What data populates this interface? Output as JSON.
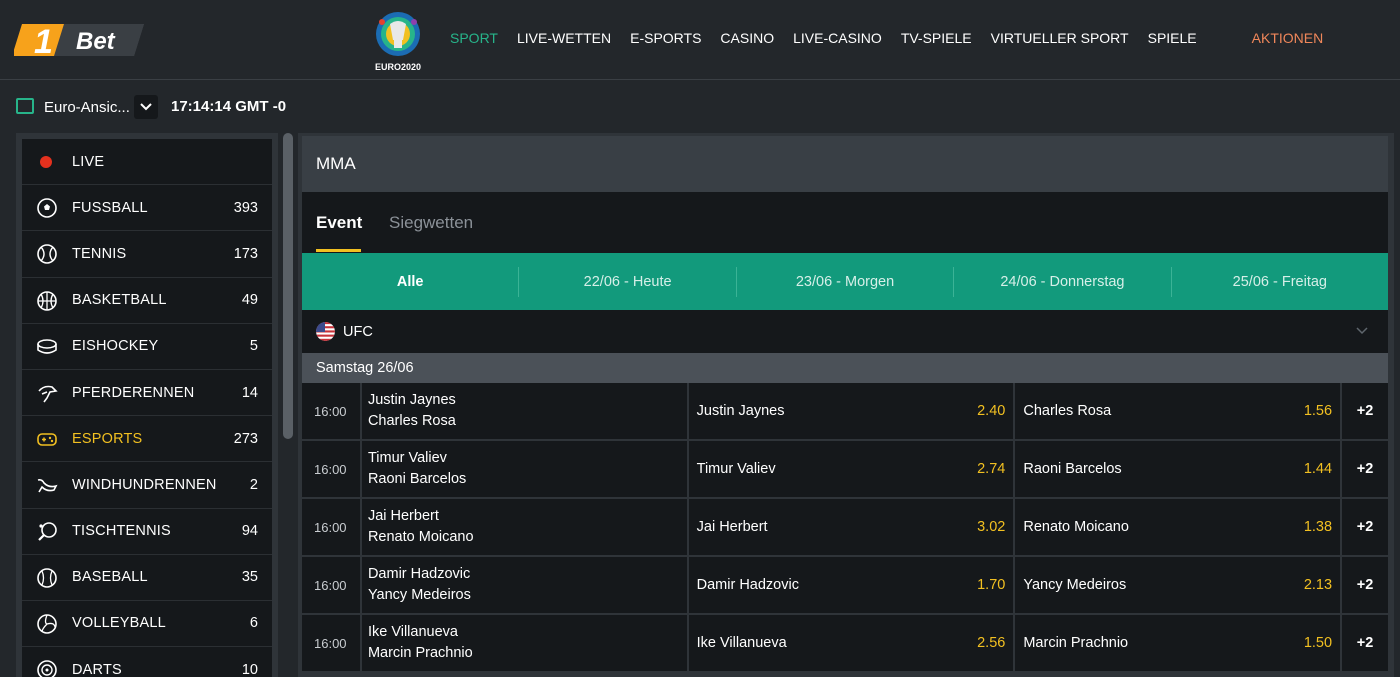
{
  "brand": {
    "logo_digit": "1",
    "logo_text": "Bet",
    "euro_text": "EURO2020"
  },
  "nav": {
    "items": [
      "SPORT",
      "LIVE-WETTEN",
      "E-SPORTS",
      "CASINO",
      "LIVE-CASINO",
      "TV-SPIELE",
      "VIRTUELLER SPORT",
      "SPIELE"
    ],
    "promo": "AKTIONEN",
    "active_color": "#27b48a",
    "promo_color": "#f0875a"
  },
  "subbar": {
    "view_label": "Euro-Ansic...",
    "clock": "17:14:14 GMT -0"
  },
  "sidebar": {
    "items": [
      {
        "label": "LIVE",
        "count": "",
        "icon": "live-dot-icon"
      },
      {
        "label": "FUSSBALL",
        "count": "393",
        "icon": "soccer-ball-icon"
      },
      {
        "label": "TENNIS",
        "count": "173",
        "icon": "tennis-ball-icon"
      },
      {
        "label": "BASKETBALL",
        "count": "49",
        "icon": "basketball-icon"
      },
      {
        "label": "EISHOCKEY",
        "count": "5",
        "icon": "hockey-puck-icon"
      },
      {
        "label": "PFERDERENNEN",
        "count": "14",
        "icon": "horse-icon"
      },
      {
        "label": "ESPORTS",
        "count": "273",
        "icon": "gamepad-icon"
      },
      {
        "label": "WINDHUNDRENNEN",
        "count": "2",
        "icon": "greyhound-icon"
      },
      {
        "label": "TISCHTENNIS",
        "count": "94",
        "icon": "table-tennis-icon"
      },
      {
        "label": "BASEBALL",
        "count": "35",
        "icon": "baseball-icon"
      },
      {
        "label": "VOLLEYBALL",
        "count": "6",
        "icon": "volleyball-icon"
      },
      {
        "label": "DARTS",
        "count": "10",
        "icon": "dartboard-icon"
      }
    ],
    "highlight_color": "#f2c021"
  },
  "main": {
    "sport_title": "MMA",
    "tabs": [
      "Event",
      "Siegwetten"
    ],
    "dates": [
      "Alle",
      "22/06 - Heute",
      "23/06 - Morgen",
      "24/06 - Donnerstag",
      "25/06 - Freitag"
    ],
    "league": "UFC",
    "day": "Samstag 26/06",
    "events": [
      {
        "time": "16:00",
        "home": "Justin Jaynes",
        "away": "Charles Rosa",
        "odd1": "2.40",
        "odd2": "1.56",
        "more": "+2"
      },
      {
        "time": "16:00",
        "home": "Timur Valiev",
        "away": "Raoni Barcelos",
        "odd1": "2.74",
        "odd2": "1.44",
        "more": "+2"
      },
      {
        "time": "16:00",
        "home": "Jai Herbert",
        "away": "Renato Moicano",
        "odd1": "3.02",
        "odd2": "1.38",
        "more": "+2"
      },
      {
        "time": "16:00",
        "home": "Damir Hadzovic",
        "away": "Yancy Medeiros",
        "odd1": "1.70",
        "odd2": "2.13",
        "more": "+2"
      },
      {
        "time": "16:00",
        "home": "Ike Villanueva",
        "away": "Marcin Prachnio",
        "odd1": "2.56",
        "odd2": "1.50",
        "more": "+2"
      }
    ],
    "accent_green": "#129a7c",
    "odds_color": "#f2c021"
  }
}
